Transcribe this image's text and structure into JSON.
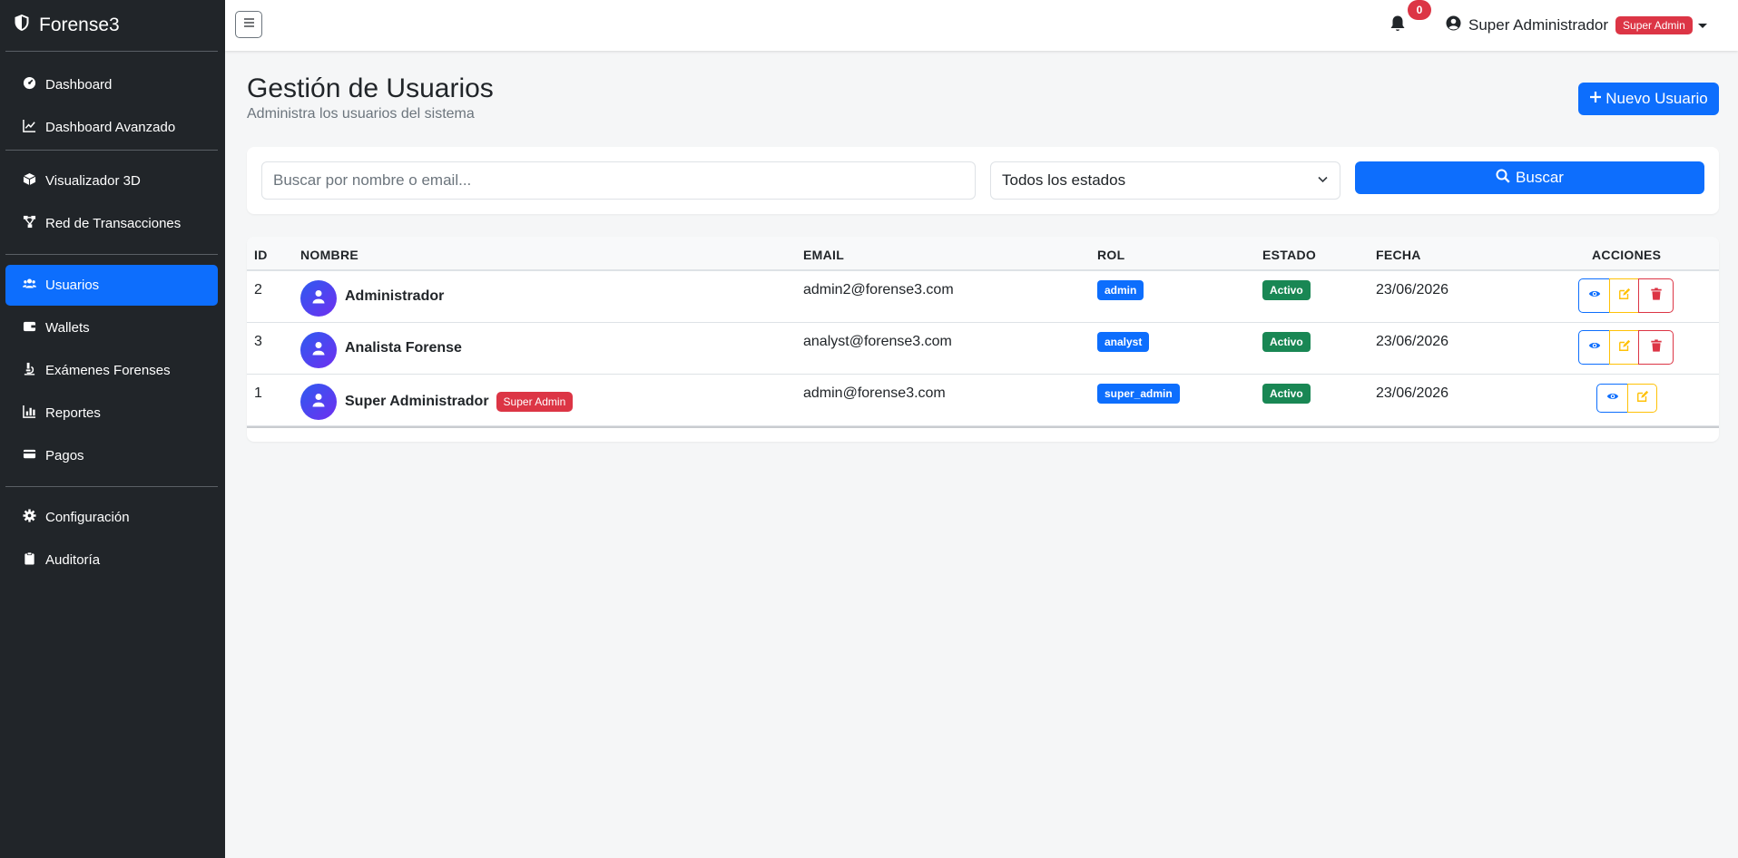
{
  "app": {
    "name": "Forense3"
  },
  "sidebar": {
    "groups": [
      [
        {
          "label": "Dashboard",
          "icon": "gauge-icon"
        },
        {
          "label": "Dashboard Avanzado",
          "icon": "chart-line-icon"
        }
      ],
      [
        {
          "label": "Visualizador 3D",
          "icon": "cube-icon"
        },
        {
          "label": "Red de Transacciones",
          "icon": "network-icon"
        }
      ],
      [
        {
          "label": "Usuarios",
          "icon": "users-icon",
          "active": true
        },
        {
          "label": "Wallets",
          "icon": "wallet-icon"
        },
        {
          "label": "Exámenes Forenses",
          "icon": "microscope-icon"
        },
        {
          "label": "Reportes",
          "icon": "chart-bar-icon"
        },
        {
          "label": "Pagos",
          "icon": "credit-card-icon"
        }
      ],
      [
        {
          "label": "Configuración",
          "icon": "gear-icon"
        },
        {
          "label": "Auditoría",
          "icon": "clipboard-icon"
        }
      ]
    ]
  },
  "topbar": {
    "notifications": "0",
    "user_name": "Super Administrador",
    "user_role_badge": "Super Admin"
  },
  "page": {
    "title": "Gestión de Usuarios",
    "subtitle": "Administra los usuarios del sistema",
    "new_button": "Nuevo Usuario"
  },
  "filters": {
    "search_placeholder": "Buscar por nombre o email...",
    "search_value": "",
    "status_selected": "Todos los estados",
    "search_button": "Buscar"
  },
  "table": {
    "headers": {
      "id": "ID",
      "name": "NOMBRE",
      "email": "EMAIL",
      "role": "ROL",
      "status": "ESTADO",
      "date": "FECHA",
      "actions": "ACCIONES"
    },
    "rows": [
      {
        "id": "2",
        "name": "Administrador",
        "badge": "",
        "email": "admin2@forense3.com",
        "role": "admin",
        "status": "Activo",
        "date": "23/06/2026",
        "can_delete": true
      },
      {
        "id": "3",
        "name": "Analista Forense",
        "badge": "",
        "email": "analyst@forense3.com",
        "role": "analyst",
        "status": "Activo",
        "date": "23/06/2026",
        "can_delete": true
      },
      {
        "id": "1",
        "name": "Super Administrador",
        "badge": "Super Admin",
        "email": "admin@forense3.com",
        "role": "super_admin",
        "status": "Activo",
        "date": "23/06/2026",
        "can_delete": false
      }
    ]
  },
  "colors": {
    "primary": "#0d6efd",
    "danger": "#dc3545",
    "success": "#198754",
    "warning": "#ffc107",
    "sidebar": "#212529"
  }
}
